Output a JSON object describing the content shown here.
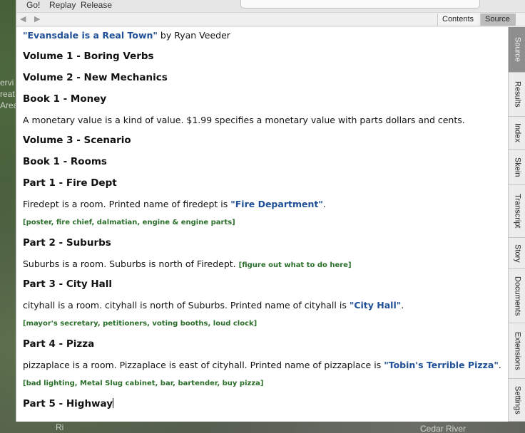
{
  "toolbar": {
    "go": "Go!",
    "replay": "Replay",
    "release": "Release"
  },
  "map": {
    "left_label_lines": [
      "ervi",
      "reat",
      "Area"
    ],
    "bottom_right": "Cedar River",
    "bottom_left": "Ri"
  },
  "nav": {
    "back_icon": "◀",
    "forward_icon": "▶",
    "contents": "Contents",
    "source": "Source"
  },
  "doc": {
    "title": "\"Evansdale is a Real Town\"",
    "author": " by Ryan Veeder",
    "blocks": [
      {
        "kind": "h",
        "text": "Volume 1 - Boring Verbs"
      },
      {
        "kind": "h",
        "text": "Volume 2 - New Mechanics"
      },
      {
        "kind": "h",
        "text": "Book 1 - Money"
      },
      {
        "kind": "p",
        "parts": [
          {
            "t": "A monetary value is a kind of value. $1.99 specifies a monetary value with parts dollars and cents."
          }
        ]
      },
      {
        "kind": "h",
        "text": "Volume 3 - Scenario"
      },
      {
        "kind": "h",
        "text": "Book 1 - Rooms"
      },
      {
        "kind": "h",
        "text": "Part 1 - Fire Dept"
      },
      {
        "kind": "p",
        "parts": [
          {
            "t": "Firedept is a room. Printed name of firedept is "
          },
          {
            "t": "\"Fire Department\"",
            "q": true
          },
          {
            "t": "."
          }
        ]
      },
      {
        "kind": "note",
        "text": "[poster, fire chief, dalmatian, engine & engine parts]"
      },
      {
        "kind": "h",
        "text": "Part 2 - Suburbs"
      },
      {
        "kind": "p",
        "parts": [
          {
            "t": "Suburbs is a room. Suburbs is north of Firedept. "
          },
          {
            "t": "[figure out what to do here]",
            "n": true
          }
        ]
      },
      {
        "kind": "h",
        "text": "Part 3 - City Hall"
      },
      {
        "kind": "p",
        "parts": [
          {
            "t": "cityhall is a room. cityhall is north of Suburbs. Printed name of cityhall is "
          },
          {
            "t": "\"City Hall\"",
            "q": true
          },
          {
            "t": "."
          }
        ]
      },
      {
        "kind": "note",
        "text": "[mayor's secretary, petitioners, voting booths, loud clock]"
      },
      {
        "kind": "h",
        "text": "Part 4 - Pizza"
      },
      {
        "kind": "p",
        "parts": [
          {
            "t": "pizzaplace is a room. Pizzaplace is east of cityhall. Printed name of pizzaplace is "
          },
          {
            "t": "\"Tobin's Terrible Pizza\"",
            "q": true
          },
          {
            "t": "."
          }
        ]
      },
      {
        "kind": "note",
        "text": "[bad lighting, Metal Slug cabinet, bar, bartender, buy pizza]"
      },
      {
        "kind": "h",
        "text": "Part 5 - Highway",
        "caret": true
      }
    ]
  },
  "side_tabs": [
    {
      "label": "Source",
      "active": true
    },
    {
      "label": "Results"
    },
    {
      "label": "Index"
    },
    {
      "label": "Skein"
    },
    {
      "label": "Transcript"
    },
    {
      "label": "Story"
    },
    {
      "label": "Documents"
    },
    {
      "label": "Extensions"
    },
    {
      "label": "Settings"
    }
  ]
}
